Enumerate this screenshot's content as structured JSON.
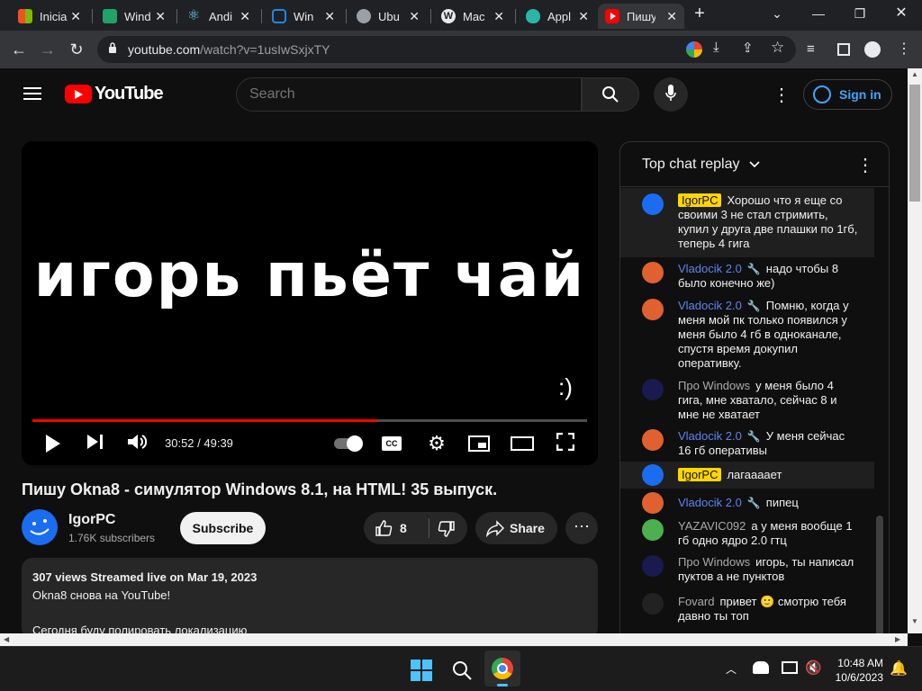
{
  "browser": {
    "tabs": [
      {
        "title": "Inicia",
        "icon": "windows-icon",
        "color": "#f25022"
      },
      {
        "title": "Wind",
        "icon": "spreadsheet-icon",
        "color": "#21a366"
      },
      {
        "title": "Andi",
        "icon": "react-icon",
        "color": "#61dafb"
      },
      {
        "title": "Win",
        "icon": "app-icon",
        "color": "#1e88e5"
      },
      {
        "title": "Ubu",
        "icon": "globe-icon",
        "color": "#9aa0a6"
      },
      {
        "title": "Mac",
        "icon": "wordpress-icon",
        "color": "#e8eaed"
      },
      {
        "title": "Appl",
        "icon": "apple-icon",
        "color": "#2ab5a8"
      },
      {
        "title": "Пишу",
        "icon": "youtube-icon",
        "color": "#ff0000"
      }
    ],
    "url_host": "youtube.com",
    "url_path": "/watch?v=1usIwSxjxTY"
  },
  "yt": {
    "logo_text": "YouTube",
    "search_placeholder": "Search",
    "sign_in": "Sign in"
  },
  "player": {
    "overlay_text": "игорь пьёт чай",
    "smiley": ":)",
    "time": "30:52 / 49:39",
    "progress": 0.6215,
    "buffered": 0.6215
  },
  "video": {
    "title": "Пишу Okna8 - симулятор Windows 8.1, на HTML! 35 выпуск.",
    "channel": "IgorPC",
    "subscribers": "1.76K subscribers",
    "subscribe_label": "Subscribe",
    "likes": "8",
    "share_label": "Share",
    "desc_meta": "307 views  Streamed live on Mar 19, 2023",
    "desc_line1": "Okna8 снова на YouTube!",
    "desc_line2": "Сегодня буду полировать локализацию"
  },
  "chat": {
    "title": "Top chat replay",
    "messages": [
      {
        "author": "IgorPC",
        "type": "owner",
        "text": "Хорошо что я еще со своими 3 не стал стримить, купил у друга две плашки по 1гб, теперь 4 гига",
        "avatar": "#1a6cf0"
      },
      {
        "author": "Vladocik 2.0",
        "type": "member",
        "text": "надо чтобы 8 было конечно же)",
        "avatar": "#e06030"
      },
      {
        "author": "Vladocik 2.0",
        "type": "member",
        "text": "Помню, когда у меня мой пк только появился у меня было 4 гб в одноканале, спустя время докупил оперативку.",
        "avatar": "#e06030"
      },
      {
        "author": "Про Windows",
        "type": "normal",
        "text": "у меня было 4 гига, мне хватало, сейчас 8 и мне не хватает",
        "avatar": "#1a1a50"
      },
      {
        "author": "Vladocik 2.0",
        "type": "member",
        "text": "У меня сейчас 16 гб оперативы",
        "avatar": "#e06030"
      },
      {
        "author": "IgorPC",
        "type": "owner",
        "text": "лагаааает",
        "avatar": "#1a6cf0"
      },
      {
        "author": "Vladocik 2.0",
        "type": "member",
        "text": "пипец",
        "avatar": "#e06030"
      },
      {
        "author": "YAZAVIC092",
        "type": "normal",
        "text": "а у меня вообще 1 гб одно ядро 2.0 гтц",
        "avatar": "#4caf50"
      },
      {
        "author": "Про Windows",
        "type": "normal",
        "text": "игорь, ты написал пуктов а не пунктов",
        "avatar": "#1a1a50"
      },
      {
        "author": "Fovard",
        "type": "normal",
        "text": "привет 🙂 смотрю тебя давно ты топ",
        "avatar": "#222"
      }
    ]
  },
  "taskbar": {
    "time": "10:48 AM",
    "date": "10/6/2023"
  }
}
